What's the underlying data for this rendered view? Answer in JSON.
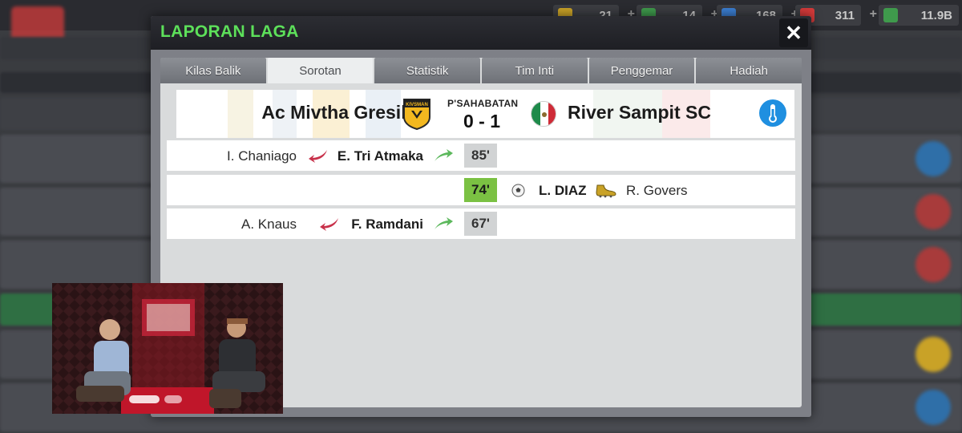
{
  "background": {
    "resources": [
      {
        "value": "21",
        "color": "#c9a227"
      },
      {
        "value": "14",
        "color": "#3f9a4c"
      },
      {
        "value": "168",
        "color": "#3b7ed1"
      },
      {
        "value": "311",
        "color": "#d43a3a"
      },
      {
        "value": "11.9B",
        "color": "#3f9a4c"
      }
    ]
  },
  "dialog": {
    "title": "LAPORAN LAGA",
    "close_icon": "✕"
  },
  "tabs": [
    {
      "label": "Kilas Balik",
      "active": false
    },
    {
      "label": "Sorotan",
      "active": true
    },
    {
      "label": "Statistik",
      "active": false
    },
    {
      "label": "Tim Inti",
      "active": false
    },
    {
      "label": "Penggemar",
      "active": false
    },
    {
      "label": "Hadiah",
      "active": false
    }
  ],
  "match": {
    "home_team": "Ac Mivtha Gresik",
    "home_badge_text": "KIVSMAN",
    "competition": "P'SAHABATAN",
    "score": "0 - 1",
    "away_team": "River Sampit SC"
  },
  "events": [
    {
      "type": "substitution",
      "player_off": "I. Chaniago",
      "player_on": "E. Tri Atmaka",
      "minute": "85'"
    },
    {
      "type": "goal",
      "minute": "74'",
      "scorer": "L. DIAZ",
      "assist": "R. Govers"
    },
    {
      "type": "substitution",
      "player_off": "A. Knaus",
      "player_on": "F. Ramdani",
      "minute": "67'"
    }
  ],
  "colors": {
    "title_green": "#5de05a",
    "goal_minute": "#7bc143",
    "sub_off_arrow": "#c8314a",
    "sub_on_arrow": "#5cb85c",
    "thermo": "#1f8fe0"
  }
}
